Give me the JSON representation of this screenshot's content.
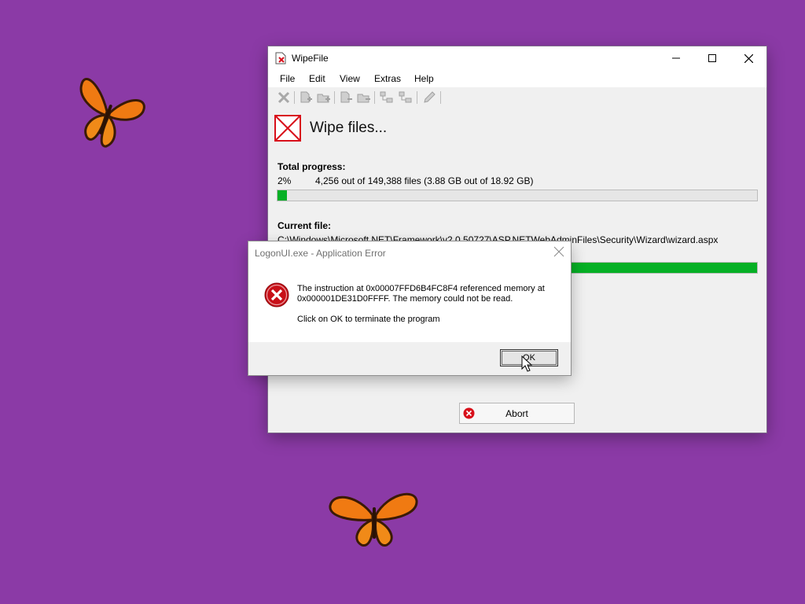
{
  "window": {
    "title": "WipeFile",
    "menu": [
      "File",
      "Edit",
      "View",
      "Extras",
      "Help"
    ],
    "toolbar_icons": [
      "delete-icon",
      "add-file-icon",
      "add-folder-icon",
      "remove-file-icon",
      "remove-folder-icon",
      "expand-icon",
      "collapse-icon",
      "edit-icon"
    ]
  },
  "wipe": {
    "heading": "Wipe files...",
    "total_label": "Total progress:",
    "total_percent": "2%",
    "total_detail": "4,256 out of 149,388 files (3.88 GB out of 18.92 GB)",
    "total_fraction": 0.02,
    "current_label": "Current file:",
    "current_path": "C:\\Windows\\Microsoft.NET\\Framework\\v2.0.50727\\ASP.NETWebAdminFiles\\Security\\Wizard\\wizard.aspx",
    "current_fraction": 1.0,
    "abort_label": "Abort"
  },
  "dialog": {
    "title": "LogonUI.exe - Application Error",
    "message": "The instruction at 0x00007FFD6B4FC8F4 referenced memory at 0x000001DE31D0FFFF. The memory could not be read.",
    "message2": "Click on OK to terminate the program",
    "ok_label": "OK"
  },
  "colors": {
    "desktop": "#8b3aa6",
    "progress_green": "#06b025",
    "error_red": "#d8101b"
  }
}
